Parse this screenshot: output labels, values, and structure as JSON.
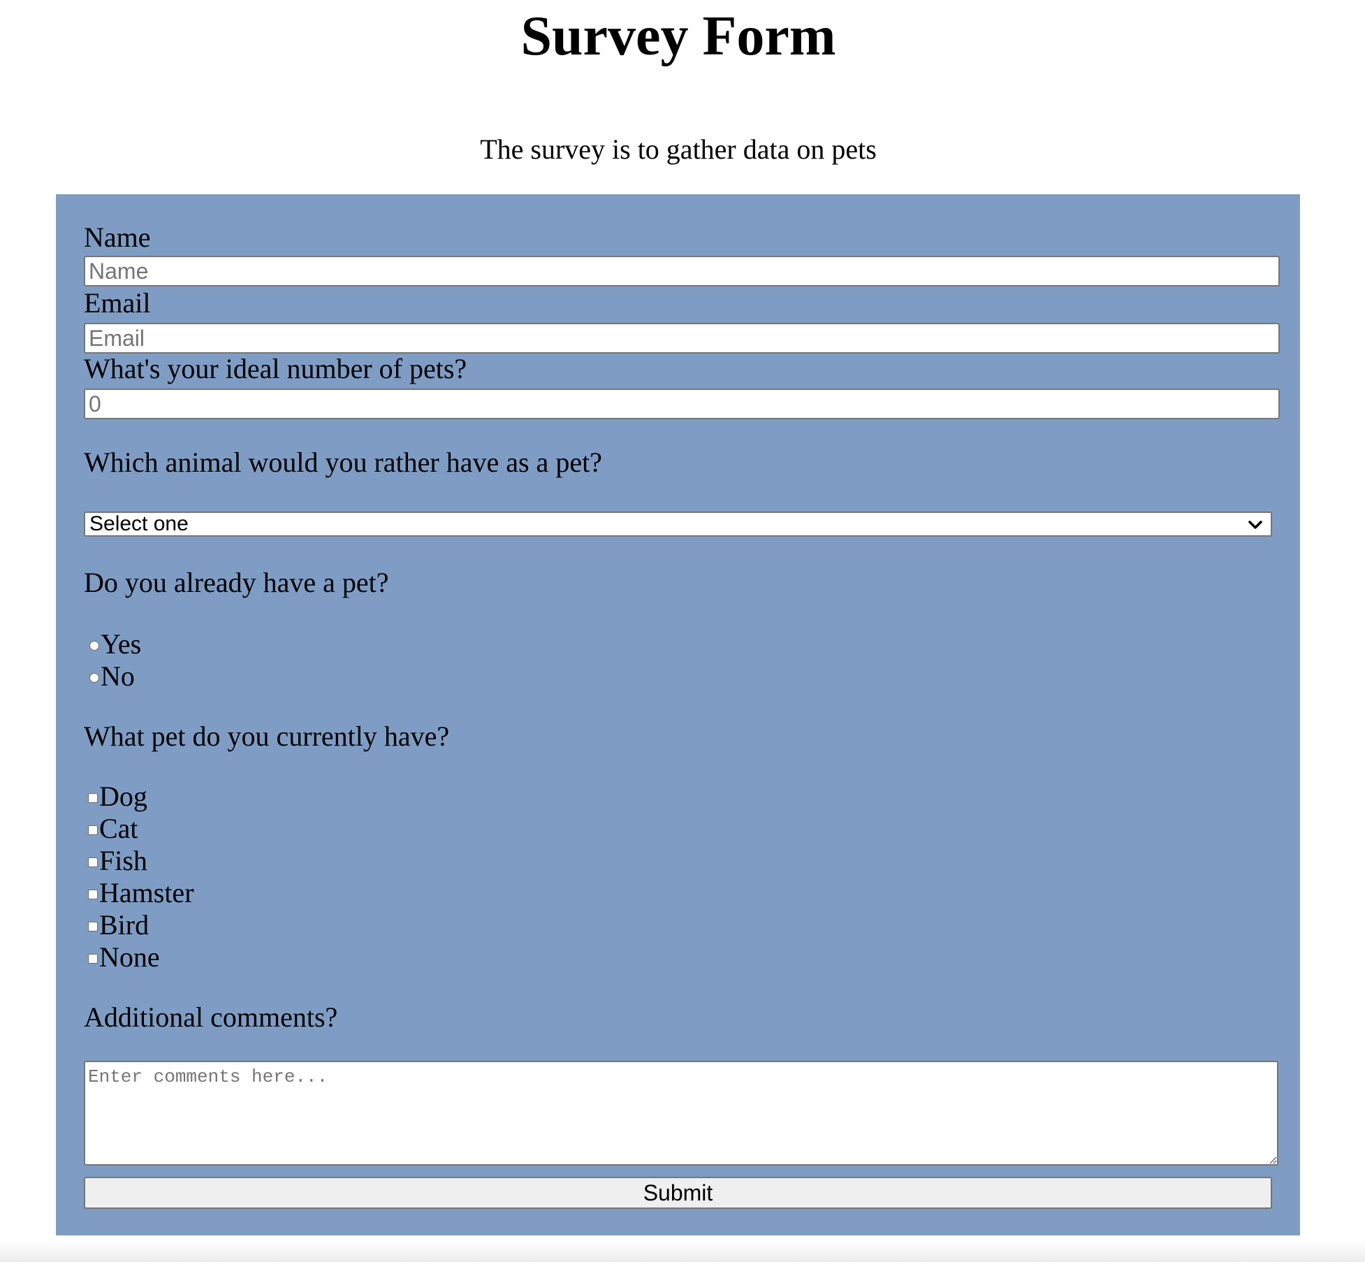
{
  "header": {
    "title": "Survey Form",
    "description": "The survey is to gather data on pets"
  },
  "form": {
    "name": {
      "label": "Name",
      "placeholder": "Name",
      "value": ""
    },
    "email": {
      "label": "Email",
      "placeholder": "Email",
      "value": ""
    },
    "number": {
      "label": "What's your ideal number of pets?",
      "placeholder": "0",
      "value": ""
    },
    "animal": {
      "label": "Which animal would you rather have as a pet?",
      "selected": "Select one"
    },
    "has_pet": {
      "label": "Do you already have a pet?",
      "options": [
        {
          "label": "Yes",
          "checked": false
        },
        {
          "label": "No",
          "checked": false
        }
      ]
    },
    "current_pets": {
      "label": "What pet do you currently have?",
      "options": [
        {
          "label": "Dog",
          "checked": false
        },
        {
          "label": "Cat",
          "checked": false
        },
        {
          "label": "Fish",
          "checked": false
        },
        {
          "label": "Hamster",
          "checked": false
        },
        {
          "label": "Bird",
          "checked": false
        },
        {
          "label": "None",
          "checked": false
        }
      ]
    },
    "comments": {
      "label": "Additional comments?",
      "placeholder": "Enter comments here...",
      "value": ""
    },
    "submit_label": "Submit"
  },
  "colors": {
    "form_background": "#7f9dc4",
    "page_background": "#ffffff",
    "button_background": "#efefef"
  }
}
